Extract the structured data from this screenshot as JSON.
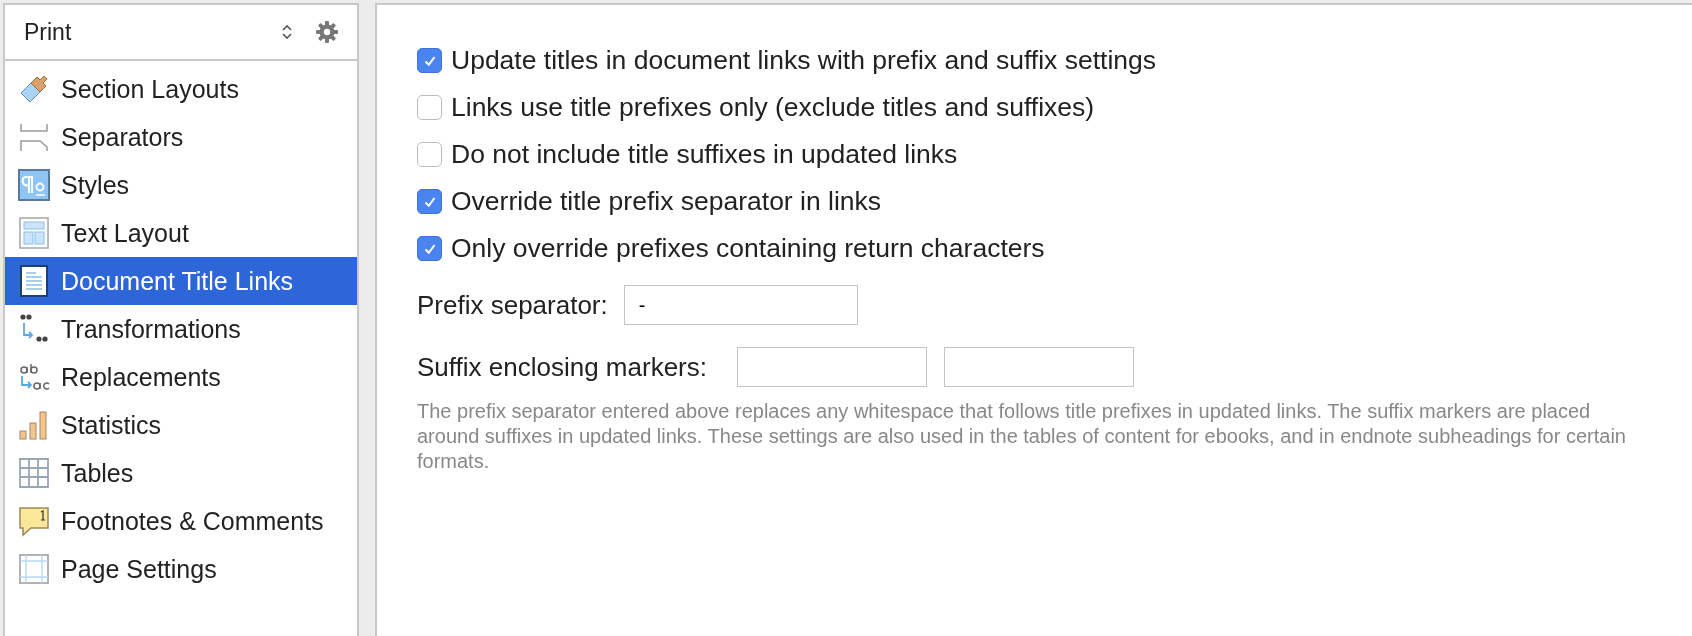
{
  "sidebar": {
    "selector": {
      "value": "Print"
    },
    "items": [
      {
        "label": "Section Layouts",
        "selected": false
      },
      {
        "label": "Separators",
        "selected": false
      },
      {
        "label": "Styles",
        "selected": false
      },
      {
        "label": "Text Layout",
        "selected": false
      },
      {
        "label": "Document Title Links",
        "selected": true
      },
      {
        "label": "Transformations",
        "selected": false
      },
      {
        "label": "Replacements",
        "selected": false
      },
      {
        "label": "Statistics",
        "selected": false
      },
      {
        "label": "Tables",
        "selected": false
      },
      {
        "label": "Footnotes & Comments",
        "selected": false
      },
      {
        "label": "Page Settings",
        "selected": false
      }
    ]
  },
  "options": [
    {
      "label": "Update titles in document links with prefix and suffix settings",
      "checked": true
    },
    {
      "label": "Links use title prefixes only (exclude titles and suffixes)",
      "checked": false
    },
    {
      "label": "Do not include title suffixes in updated links",
      "checked": false
    },
    {
      "label": "Override title prefix separator in links",
      "checked": true
    },
    {
      "label": "Only override prefixes containing return characters",
      "checked": true
    }
  ],
  "prefix_separator": {
    "label": "Prefix separator:",
    "value": "-"
  },
  "suffix_markers": {
    "label": "Suffix enclosing markers:"
  },
  "help_text": "The prefix separator entered above replaces any whitespace that follows title prefixes in updated links. The suffix markers are placed around suffixes in updated links. These settings are also used in the tables of content for ebooks, and in endnote subheadings for certain formats."
}
